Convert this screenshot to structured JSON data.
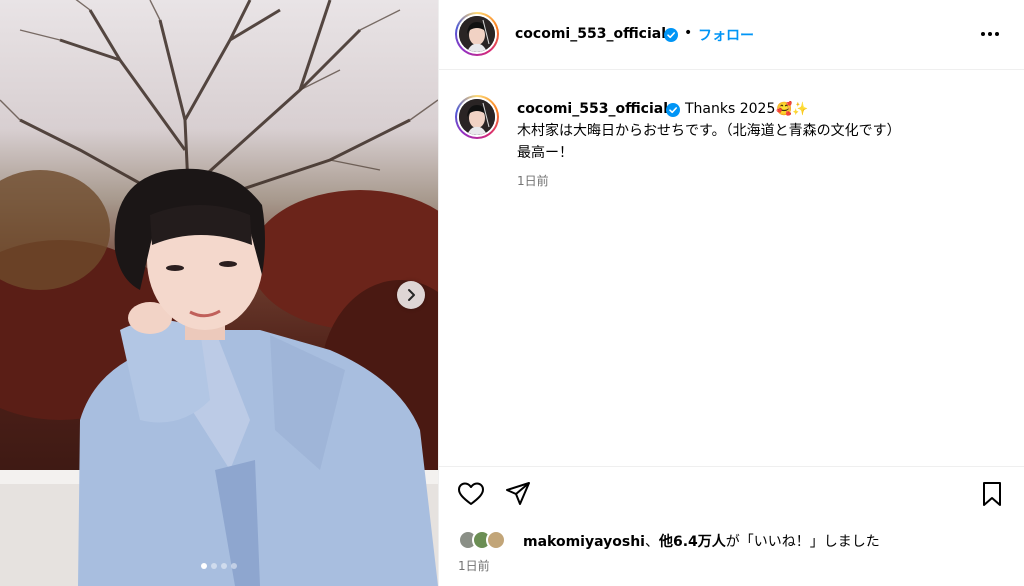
{
  "post": {
    "username": "cocomi_553_official",
    "follow_label": "フォロー",
    "bullet": "•",
    "caption": {
      "lead": "Thanks 2025",
      "emoji": "🥰✨",
      "line2": "木村家は大晦日からおせちです。（北海道と青森の文化です）",
      "line3": "最高ー！"
    },
    "caption_time": "1日前",
    "likes": {
      "user": "makomiyayoshi",
      "rest_prefix": "、",
      "count": "他6.4万人",
      "suffix": "が「いいね！」しました"
    },
    "post_time": "1日前",
    "carousel": {
      "total": 4,
      "active": 1
    }
  },
  "icons": {
    "like": "heart-icon",
    "share": "paper-plane-icon",
    "save": "bookmark-icon",
    "next": "chevron-right-icon",
    "more": "more-options-icon",
    "verified": "verified-badge-icon"
  },
  "colors": {
    "accent": "#0095f6",
    "muted": "#737373",
    "border": "#efefef"
  }
}
